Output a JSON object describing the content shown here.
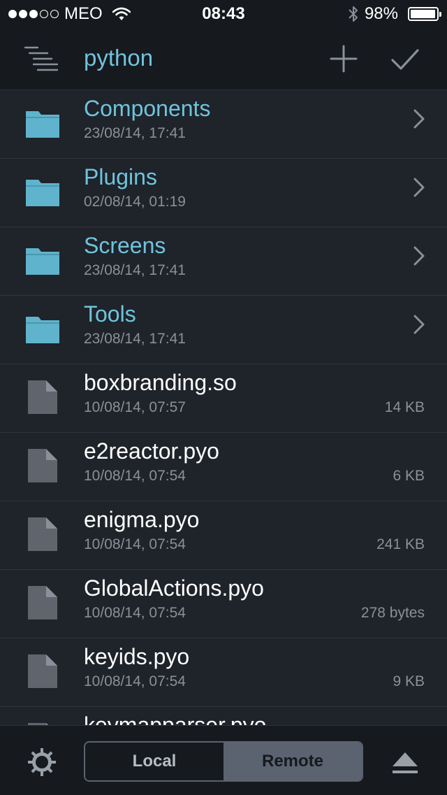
{
  "status_bar": {
    "signal_dots": [
      true,
      true,
      true,
      false,
      false
    ],
    "carrier": "MEO",
    "time": "08:43",
    "battery": "98%",
    "battery_level": 0.98
  },
  "nav": {
    "title": "python",
    "menu_icon": "list-tree-icon",
    "add_icon": "plus-icon",
    "done_icon": "checkmark-icon"
  },
  "items": [
    {
      "type": "folder",
      "name": "Components",
      "date": "23/08/14, 17:41",
      "size": ""
    },
    {
      "type": "folder",
      "name": "Plugins",
      "date": "02/08/14, 01:19",
      "size": ""
    },
    {
      "type": "folder",
      "name": "Screens",
      "date": "23/08/14, 17:41",
      "size": ""
    },
    {
      "type": "folder",
      "name": "Tools",
      "date": "23/08/14, 17:41",
      "size": ""
    },
    {
      "type": "file",
      "name": "boxbranding.so",
      "date": "10/08/14, 07:57",
      "size": "14 KB"
    },
    {
      "type": "file",
      "name": "e2reactor.pyo",
      "date": "10/08/14, 07:54",
      "size": "6 KB"
    },
    {
      "type": "file",
      "name": "enigma.pyo",
      "date": "10/08/14, 07:54",
      "size": "241 KB"
    },
    {
      "type": "file",
      "name": "GlobalActions.pyo",
      "date": "10/08/14, 07:54",
      "size": "278 bytes"
    },
    {
      "type": "file",
      "name": "keyids.pyo",
      "date": "10/08/14, 07:54",
      "size": "9 KB"
    },
    {
      "type": "file",
      "name": "keymapparser.pyo",
      "date": "",
      "size": ""
    }
  ],
  "toolbar": {
    "settings_icon": "gear-icon",
    "local_label": "Local",
    "remote_label": "Remote",
    "selected": "Remote",
    "eject_icon": "eject-icon"
  },
  "colors": {
    "accent": "#6fc4dc",
    "background": "#1f232a",
    "bar": "#16191e",
    "muted": "#8a9099"
  }
}
